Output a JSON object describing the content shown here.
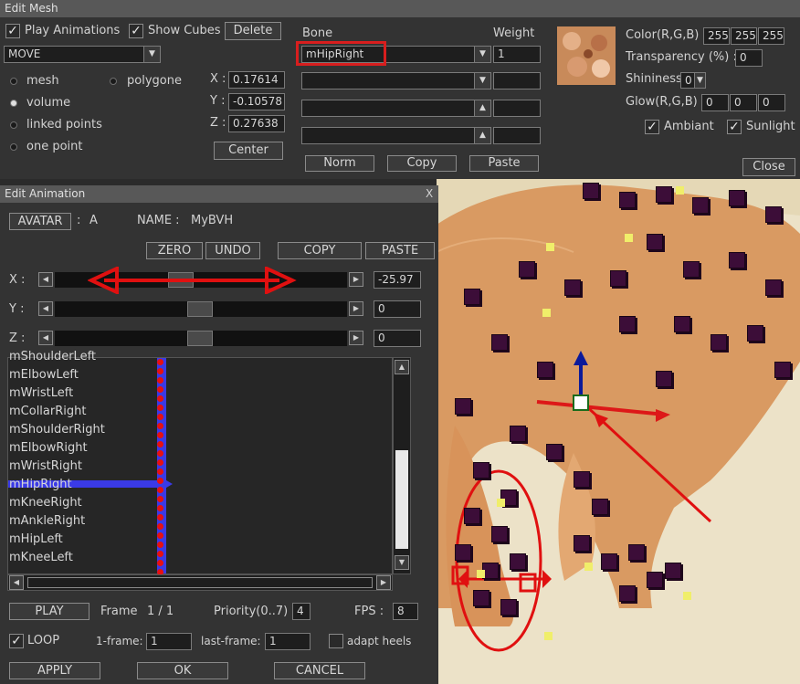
{
  "colors": {
    "panel_bg": "#333333",
    "title_bg": "#585858",
    "field_bg": "#1e1e1e",
    "timeline_blue": "#3a3ae6",
    "keyframe_red": "#e81010",
    "highlight_red": "#d81e1e",
    "skin": "#d99a62",
    "cube": "#3c0d38",
    "sky": "#ece0c4"
  },
  "edit_mesh": {
    "title": "Edit Mesh",
    "play_animations_label": "Play Animations",
    "play_animations_checked": true,
    "show_cubes_label": "Show Cubes",
    "show_cubes_checked": true,
    "delete_label": "Delete",
    "mode_value": "MOVE",
    "select_modes": [
      {
        "label": "mesh",
        "selected": false
      },
      {
        "label": "volume",
        "selected": true
      },
      {
        "label": "linked points",
        "selected": false
      },
      {
        "label": "one point",
        "selected": false
      }
    ],
    "polygone_label": "polygone",
    "x_label": "X :",
    "x_value": "0.17614",
    "y_label": "Y :",
    "y_value": "-0.10578",
    "z_label": "Z :",
    "z_value": "0.27638",
    "center_label": "Center",
    "bone_header": "Bone",
    "weight_header": "Weight",
    "bone_value": "mHipRight",
    "weight_value": "1",
    "norm_label": "Norm",
    "copy_label": "Copy",
    "paste_label": "Paste",
    "color_label": "Color(R,G,B) :",
    "color_values": [
      "255",
      "255",
      "255"
    ],
    "transparency_label": "Transparency (%) :",
    "transparency_value": "0",
    "shininess_label": "Shininess:",
    "shininess_value": "0",
    "glow_label": "Glow(R,G,B) :",
    "glow_values": [
      "0",
      "0",
      "0"
    ],
    "ambiant_label": "Ambiant",
    "ambiant_checked": true,
    "sunlight_label": "Sunlight",
    "sunlight_checked": true,
    "close_label": "Close"
  },
  "edit_animation": {
    "title": "Edit Animation",
    "close_glyph": "X",
    "avatar_label": "AVATAR",
    "avatar_sep": ":",
    "avatar_value": "A",
    "name_label": "NAME :",
    "name_value": "MyBVH",
    "zero_label": "ZERO",
    "undo_label": "UNDO",
    "copy_label": "COPY",
    "paste_label": "PASTE",
    "x_label": "X :",
    "x_value": "-25.97",
    "y_label": "Y :",
    "y_value": "0",
    "z_label": "Z :",
    "z_value": "0",
    "bones": [
      "mShoulderLeft",
      "mElbowLeft",
      "mWristLeft",
      "mCollarRight",
      "mShoulderRight",
      "mElbowRight",
      "mWristRight",
      "mHipRight",
      "mKneeRight",
      "mAnkleRight",
      "mHipLeft",
      "mKneeLeft"
    ],
    "selected_bone": "mHipRight",
    "play_label": "PLAY",
    "frame_label": "Frame",
    "frame_value": "1 / 1",
    "priority_label": "Priority(0..7) :",
    "priority_value": "4",
    "fps_label": "FPS :",
    "fps_value": "8",
    "loop_label": "LOOP",
    "loop_checked": true,
    "first_frame_label": "1-frame:",
    "first_frame_value": "1",
    "last_frame_label": "last-frame:",
    "last_frame_value": "1",
    "adapt_heels_label": "adapt heels",
    "adapt_heels_checked": false,
    "apply_label": "APPLY",
    "ok_label": "OK",
    "cancel_label": "CANCEL"
  }
}
